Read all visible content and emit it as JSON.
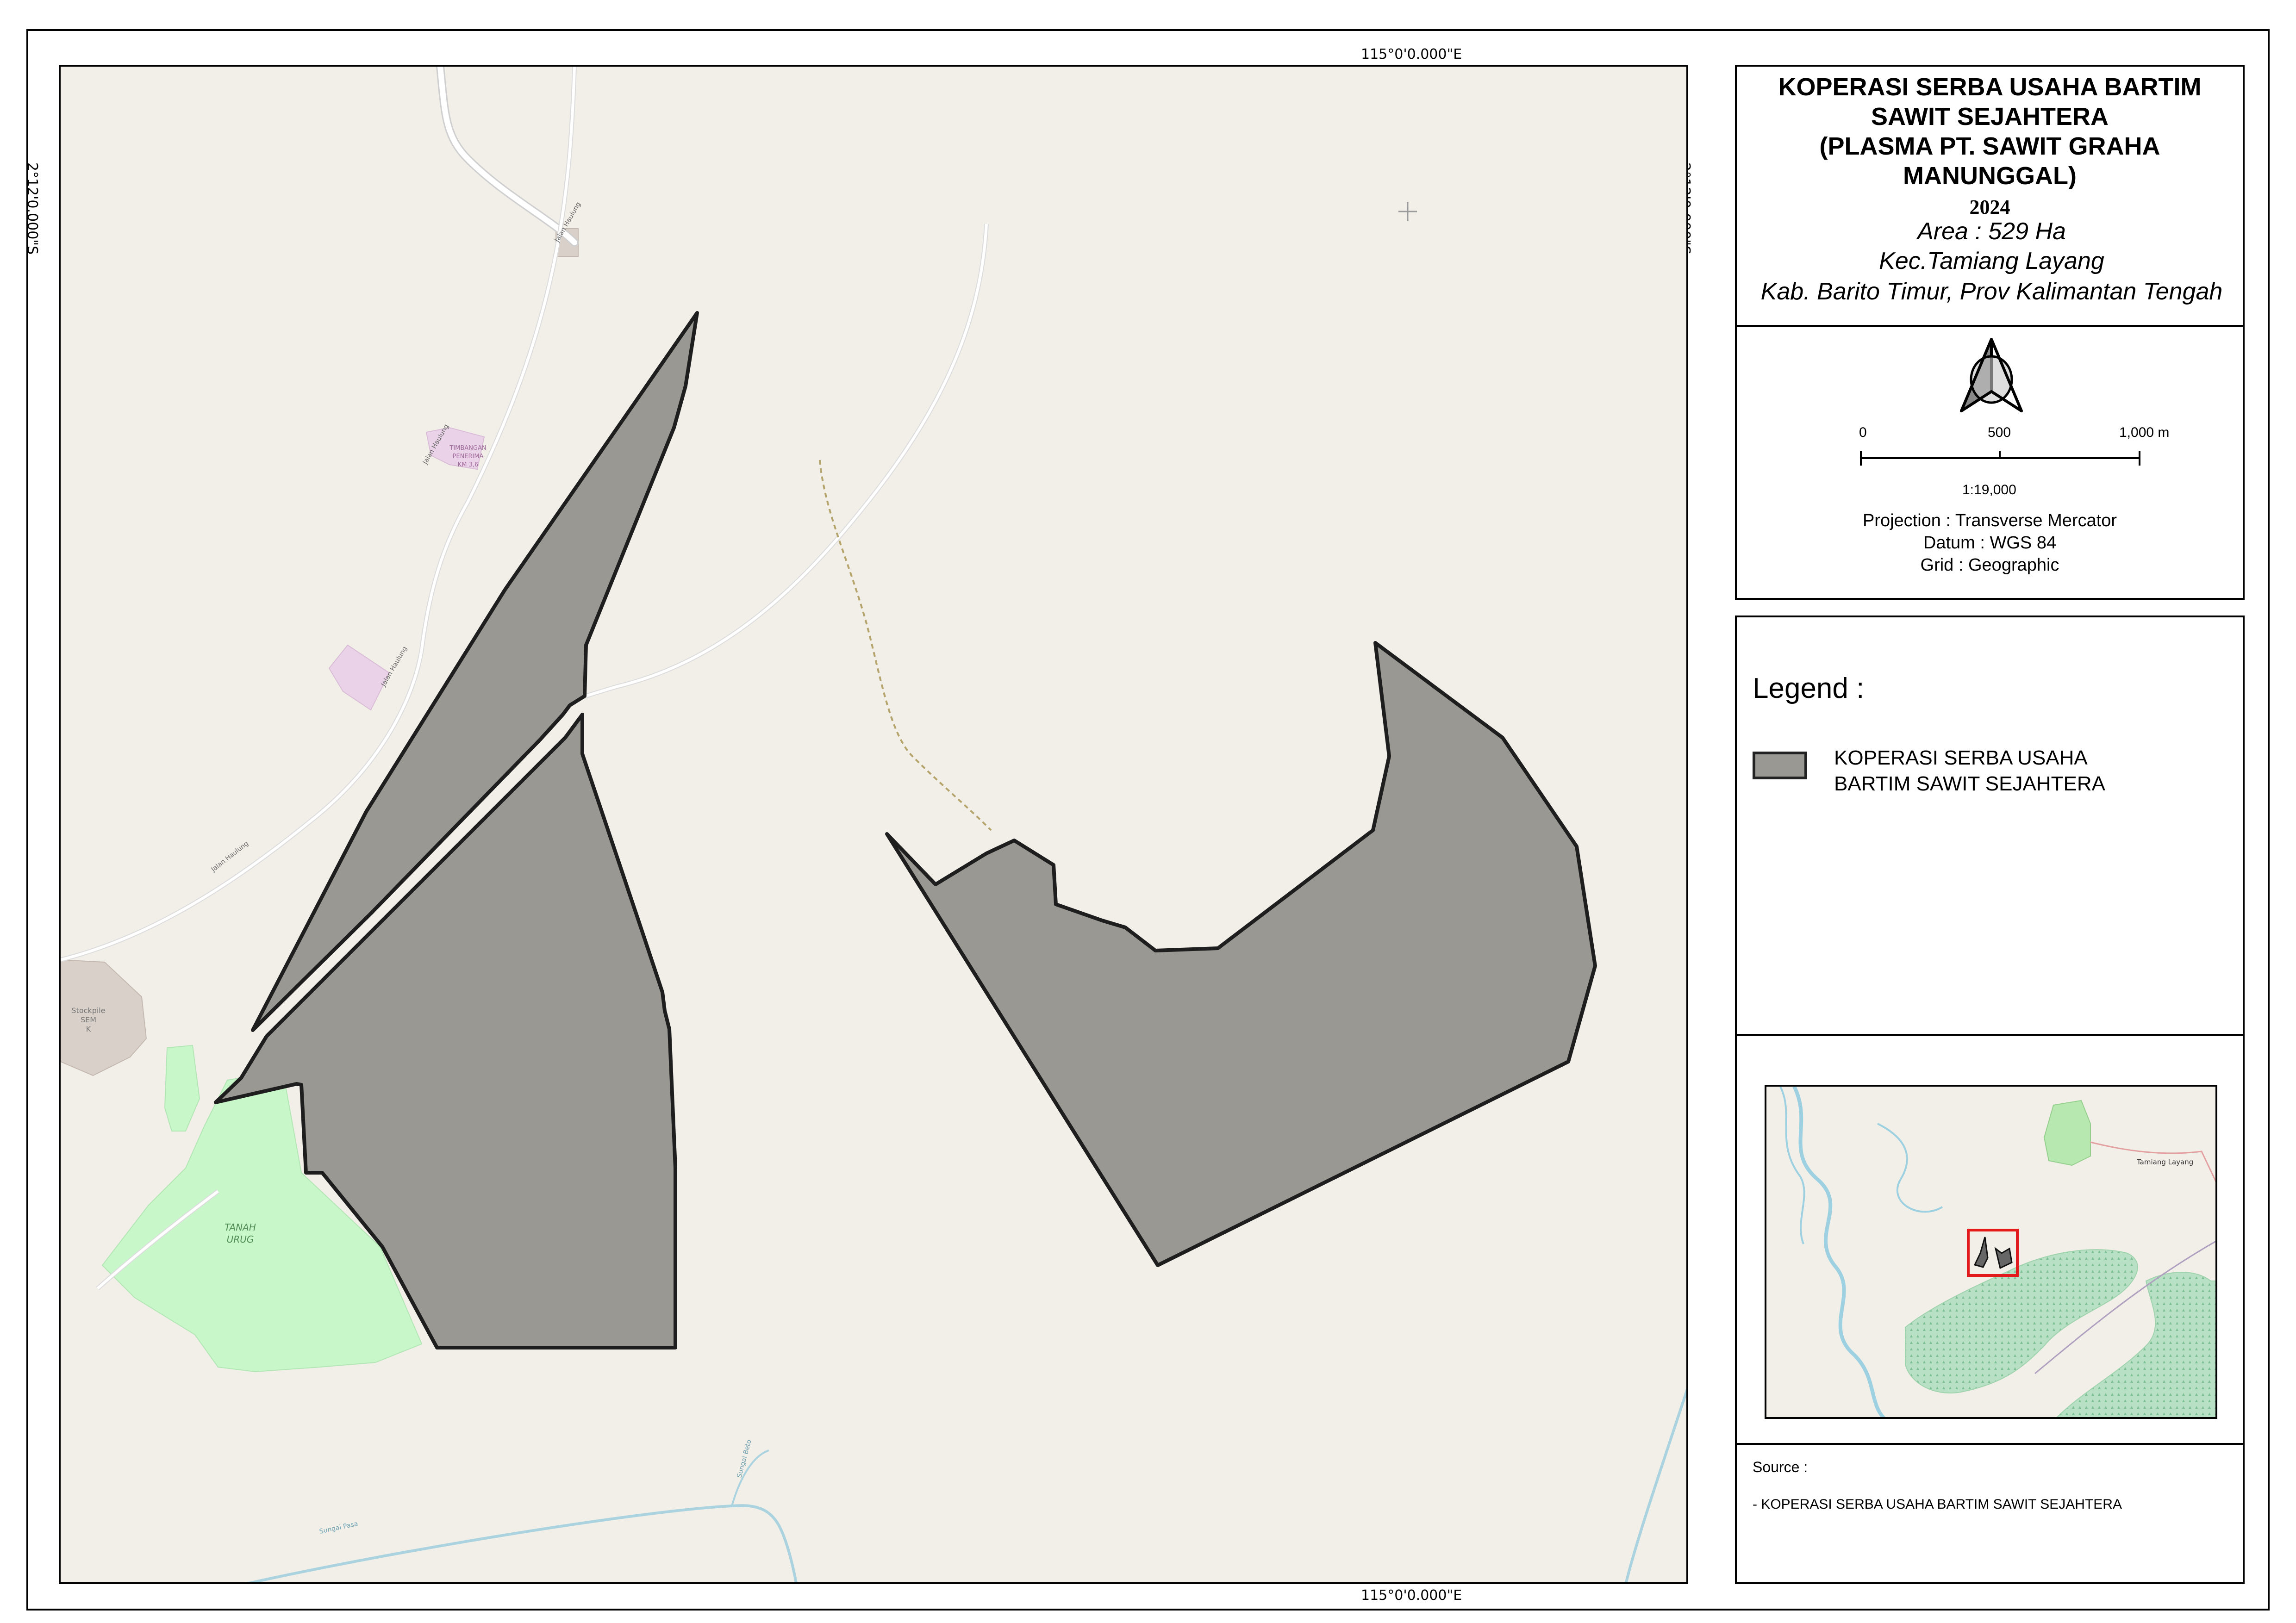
{
  "map": {
    "coordinates": {
      "top": "115°0'0.000\"E",
      "bottom": "115°0'0.000\"E",
      "left": "2°12'0.000\"S",
      "right": "2°12'0.000\"S"
    },
    "labels": {
      "road_upper": "Jalan Haulung",
      "road_mid": "Jalan Haulung",
      "road_lower": "Jalan Haulung",
      "road_upper_left": "Jalan Haulung",
      "poi_name": "TIMBANGAN",
      "poi_sub1": "PENERIMA",
      "poi_sub2": "KM 3,6",
      "stockpile": "Stockpile",
      "stockpile_sub1": "SEM",
      "stockpile_sub2": "K",
      "tanah_urug_1": "TANAH",
      "tanah_urug_2": "URUG",
      "river_a": "Sungai Pasa",
      "river_b": "Sungai Beto"
    },
    "colors": {
      "background": "#f2efe9",
      "plot_fill": "#999893",
      "plot_outline": "#1e1e1e",
      "green_area": "#c8f7c9",
      "water": "#aad3df",
      "road": "#ffffff"
    }
  },
  "title": {
    "line1": "KOPERASI SERBA USAHA BARTIM",
    "line2": "SAWIT SEJAHTERA",
    "line3": "(PLASMA PT. SAWIT GRAHA",
    "line4": "MANUNGGAL)",
    "year": "2024",
    "area": "Area : 529 Ha",
    "district": "Kec.Tamiang Layang",
    "regency": "Kab. Barito Timur, Prov Kalimantan Tengah"
  },
  "north_arrow": {
    "icon": "north-arrow-icon"
  },
  "scale_bar": {
    "label_0": "0",
    "label_mid": "500",
    "label_max": "1,000 m",
    "ratio": "1:19,000"
  },
  "projection": {
    "projection": "Projection : Transverse Mercator",
    "datum": "Datum : WGS 84",
    "grid": "Grid : Geographic"
  },
  "legend": {
    "title": "Legend :",
    "items": [
      {
        "label_line1": "KOPERASI SERBA USAHA",
        "label_line2": "BARTIM SAWIT SEJAHTERA",
        "color": "#999893"
      }
    ]
  },
  "inset": {
    "town_label": "Tamiang Layang"
  },
  "source": {
    "title": "Source :",
    "item": "- KOPERASI SERBA USAHA BARTIM SAWIT SEJAHTERA"
  }
}
